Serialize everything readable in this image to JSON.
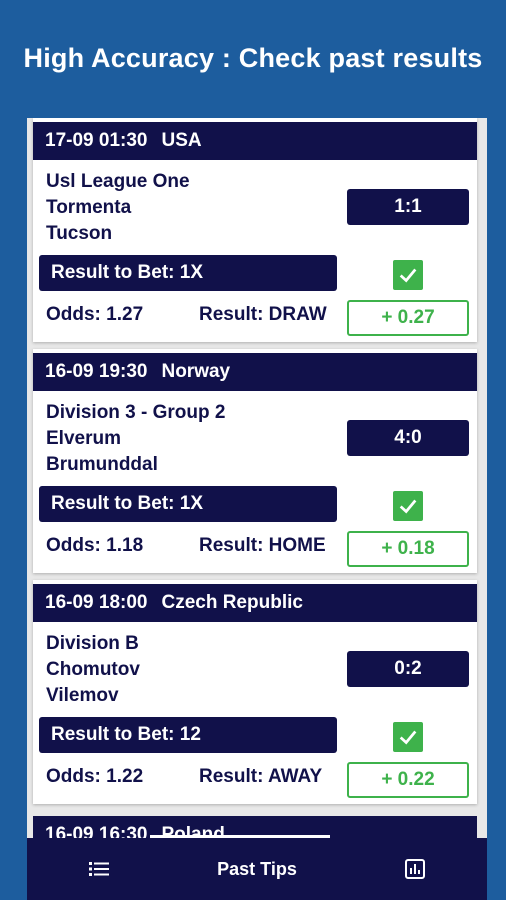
{
  "header": {
    "title": "High Accuracy : Check past results"
  },
  "matches": [
    {
      "date": "17-09 01:30",
      "country": "USA",
      "league": "Usl League One",
      "home": "Tormenta",
      "away": "Tucson",
      "score": "1:1",
      "bet": "Result to Bet: 1X",
      "odds": "Odds: 1.27",
      "result": "Result: DRAW",
      "profit": "+ 0.27"
    },
    {
      "date": "16-09 19:30",
      "country": "Norway",
      "league": "Division 3 - Group 2",
      "home": "Elverum",
      "away": "Brumunddal",
      "score": "4:0",
      "bet": "Result to Bet: 1X",
      "odds": "Odds: 1.18",
      "result": "Result: HOME",
      "profit": "+ 0.18"
    },
    {
      "date": "16-09 18:00",
      "country": "Czech Republic",
      "league": "Division B",
      "home": "Chomutov",
      "away": "Vilemov",
      "score": "0:2",
      "bet": "Result to Bet: 12",
      "odds": "Odds: 1.22",
      "result": "Result: AWAY",
      "profit": "+ 0.22"
    }
  ],
  "partial_match": {
    "date": "16-09 16:30",
    "country": "Poland"
  },
  "bottom_nav": {
    "center_label": "Past Tips",
    "left_icon": "list-icon",
    "right_icon": "chart-icon"
  },
  "colors": {
    "navy": "#11114a",
    "blue": "#1d5d9e",
    "green": "#3eb24b"
  }
}
